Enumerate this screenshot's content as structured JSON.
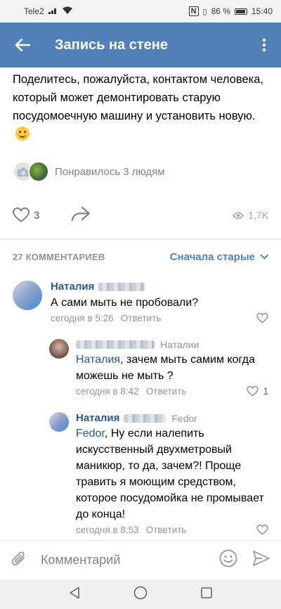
{
  "status": {
    "carrier": "Tele2",
    "battery": "86 %",
    "time": "15:40"
  },
  "header": {
    "title": "Запись на стене"
  },
  "post": {
    "text": "Поделитесь, пожалуйста, контактом человека, который может демонтировать старую посудомоечную машину и установить новую.",
    "liked_text": "Понравилось 3 людям",
    "likes": "3",
    "views": "1,7K"
  },
  "comments_header": {
    "count": "27 КОММЕНТАРИЕВ",
    "sort": "Сначала старые"
  },
  "comments": [
    {
      "author": "Наталия",
      "reply_to": "",
      "mention": "",
      "text": "А сами мыть не пробовали?",
      "time": "сегодня в 5:26",
      "reply": "Ответить",
      "likes": ""
    },
    {
      "author": "",
      "reply_to": "Наталии",
      "mention": "Наталия",
      "text": ", зачем мыть самим когда можешь не мыть ?",
      "time": "сегодня в 8:42",
      "reply": "Ответить",
      "likes": "1"
    },
    {
      "author": "Наталия",
      "reply_to": "Fedor",
      "mention": "Fedor",
      "text": ", Ну если налепить искусственный двухметровый маникюр, то да, зачем?! Проще травить я моющим средством, которое посудомойка не промывает до конца!",
      "time": "сегодня в 8:53",
      "reply": "Ответить",
      "likes": ""
    }
  ],
  "composer": {
    "placeholder": "Комментарий"
  },
  "colors": {
    "accent": "#5181b8",
    "link": "#2a5885",
    "muted": "#909499"
  }
}
